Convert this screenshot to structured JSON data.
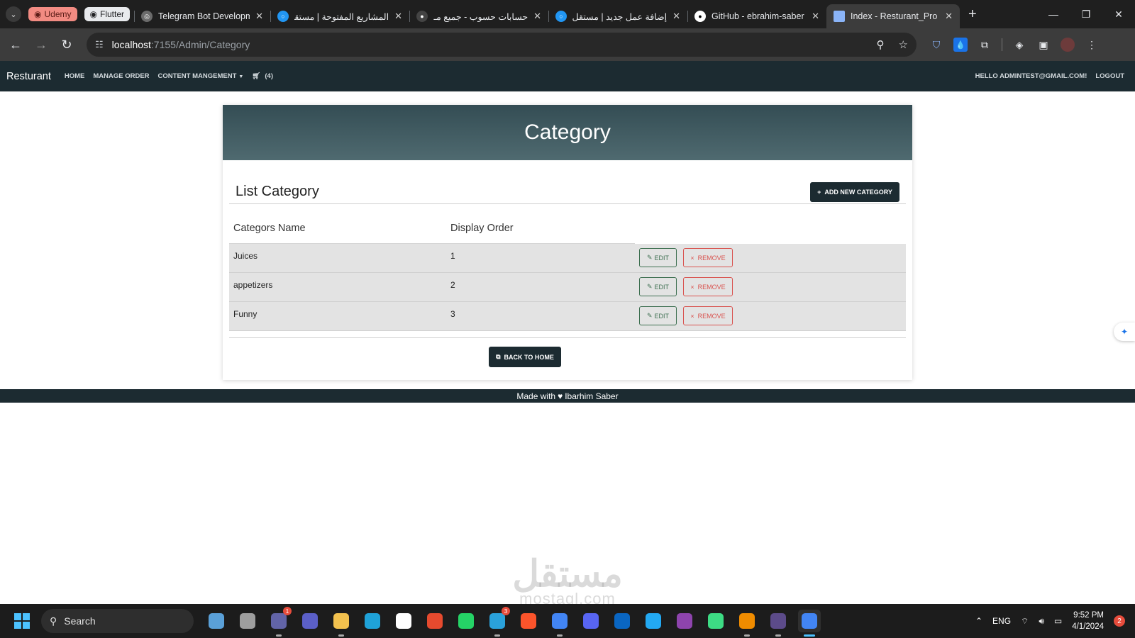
{
  "browser": {
    "groups": [
      {
        "label": "Udemy"
      },
      {
        "label": "Flutter"
      }
    ],
    "tabs": [
      {
        "title": "Telegram Bot Developm",
        "favicon_color": "#6b6b6b"
      },
      {
        "title": "المشاريع المفتوحة | مستقل",
        "favicon_color": "#2196f3"
      },
      {
        "title": "حسابات حسوب - جميع مـ",
        "favicon_color": "#444444"
      },
      {
        "title": "إضافة عمل جديد | مستقل",
        "favicon_color": "#2196f3"
      },
      {
        "title": "GitHub - ebrahim-saber",
        "favicon_color": "#ffffff"
      },
      {
        "title": "Index - Resturant_Pro",
        "favicon_color": "#8ab4f8"
      }
    ],
    "url_host": "localhost",
    "url_path": ":7155/Admin/Category"
  },
  "app": {
    "brand": "Resturant",
    "nav": {
      "home": "HOME",
      "manage_order": "MANAGE ORDER",
      "content": "CONTENT MANGEMENT",
      "cart_count": "(4)",
      "greeting": "HELLO ADMINTEST@GMAIL.COM!",
      "logout": "LOGOUT"
    }
  },
  "page": {
    "title": "Category",
    "list_title": "List Category",
    "add_button": "ADD NEW CATEGORY",
    "columns": [
      "Categors Name",
      "Display Order"
    ],
    "rows": [
      {
        "name": "Juices",
        "order": "1"
      },
      {
        "name": "appetizers",
        "order": "2"
      },
      {
        "name": "Funny",
        "order": "3"
      }
    ],
    "edit_label": "EDIT",
    "remove_label": "REMOVE",
    "back_button": "BACK TO HOME"
  },
  "footer": {
    "prefix": "Made with",
    "author": "Ibarhim Saber"
  },
  "watermark": {
    "arabic": "مستقل",
    "latin": "mostaql.com"
  },
  "taskbar": {
    "search": "Search",
    "apps": [
      {
        "name": "weather",
        "color": "#5aa0d8"
      },
      {
        "name": "file-manager",
        "color": "#9e9e9e"
      },
      {
        "name": "teams",
        "color": "#6264a7",
        "badge": "1"
      },
      {
        "name": "meet",
        "color": "#5b5fc7"
      },
      {
        "name": "explorer",
        "color": "#f2c14e"
      },
      {
        "name": "edge",
        "color": "#1fa2d8"
      },
      {
        "name": "store",
        "color": "#ffffff"
      },
      {
        "name": "git",
        "color": "#e64a2e"
      },
      {
        "name": "whatsapp",
        "color": "#25d366"
      },
      {
        "name": "telegram",
        "color": "#2aa1da",
        "badge": "3"
      },
      {
        "name": "brave",
        "color": "#fb542b"
      },
      {
        "name": "chrome",
        "color": "#4285f4"
      },
      {
        "name": "discord",
        "color": "#5865f2"
      },
      {
        "name": "linkedin",
        "color": "#0a66c2"
      },
      {
        "name": "vscode",
        "color": "#23a9f2"
      },
      {
        "name": "visual-studio",
        "color": "#8e44ad"
      },
      {
        "name": "android-studio",
        "color": "#3ddc84"
      },
      {
        "name": "vlc",
        "color": "#f08c00"
      },
      {
        "name": "terminal",
        "color": "#5c4b8a"
      },
      {
        "name": "chrome-active",
        "color": "#4285f4"
      }
    ],
    "lang": "ENG",
    "time": "9:52 PM",
    "date": "4/1/2024",
    "notifications": "2"
  }
}
